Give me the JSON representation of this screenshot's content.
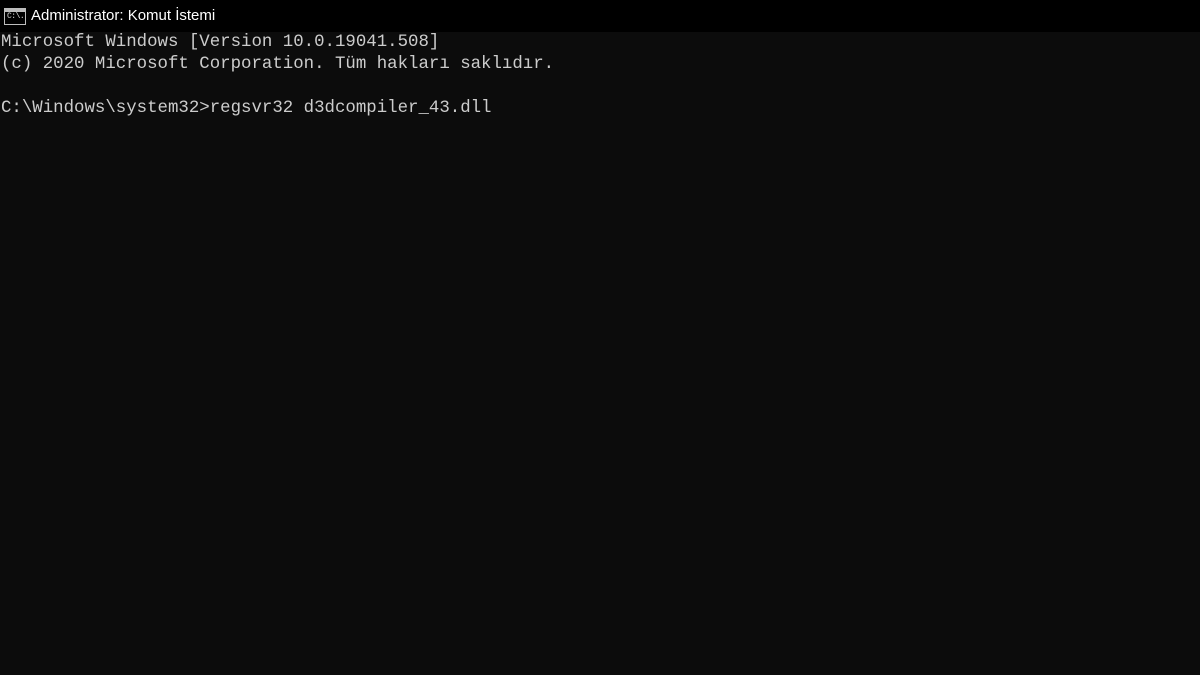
{
  "window": {
    "title": "Administrator: Komut İstemi",
    "icon": "cmd-icon",
    "icon_label": "C:\\.",
    "colors": {
      "titlebar_bg": "#000000",
      "console_bg": "#0c0c0c",
      "text": "#cccccc"
    }
  },
  "console": {
    "lines": [
      "Microsoft Windows [Version 10.0.19041.508]",
      "(c) 2020 Microsoft Corporation. Tüm hakları saklıdır.",
      "",
      "C:\\Windows\\system32>regsvr32 d3dcompiler_43.dll"
    ]
  }
}
